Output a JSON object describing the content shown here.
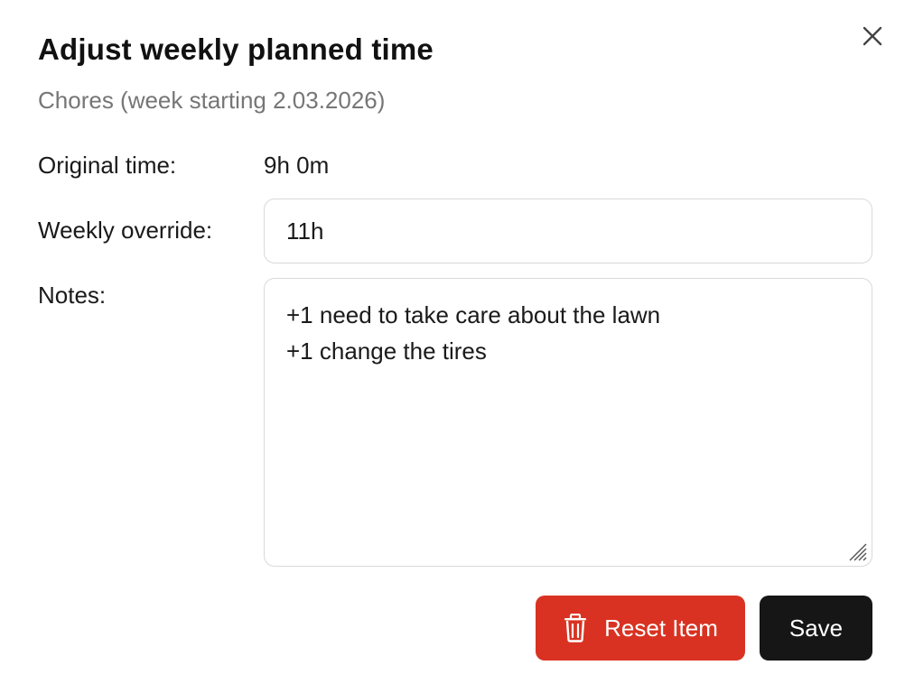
{
  "dialog": {
    "title": "Adjust weekly planned time",
    "subtitle": "Chores (week starting 2.03.2026)",
    "close_icon": "close-icon"
  },
  "form": {
    "original_time_label": "Original time:",
    "original_time_value": "9h 0m",
    "weekly_override_label": "Weekly override:",
    "weekly_override_value": "11h",
    "notes_label": "Notes:",
    "notes_lines": [
      "+1 need to take care about the lawn",
      "+1 change the tires"
    ]
  },
  "actions": {
    "reset_label": "Reset Item",
    "reset_icon": "trash-icon",
    "reset_color": "#d93222",
    "save_label": "Save",
    "save_color": "#161616"
  }
}
